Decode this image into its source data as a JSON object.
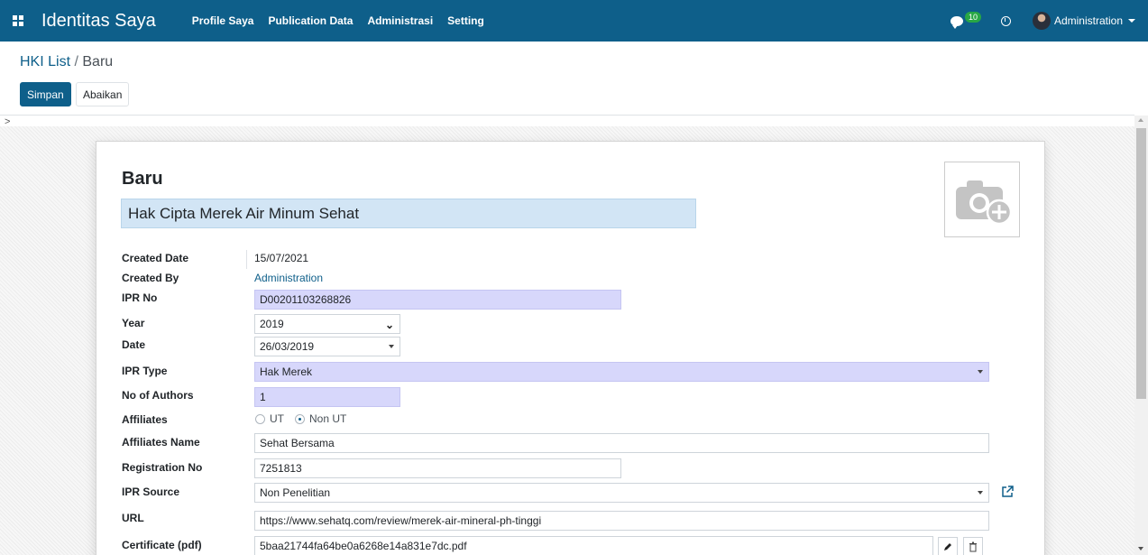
{
  "navbar": {
    "brand": "Identitas Saya",
    "menu": [
      "Profile Saya",
      "Publication Data",
      "Administrasi",
      "Setting"
    ],
    "message_count": "10",
    "user_name": "Administration",
    "color": "#0e5f8a"
  },
  "breadcrumb": {
    "parent": "HKI List",
    "separator": "/",
    "current": "Baru"
  },
  "actions": {
    "save_label": "Simpan",
    "discard_label": "Abaikan"
  },
  "form": {
    "title_label": "Baru",
    "name": "Hak Cipta Merek Air Minum Sehat",
    "fields": {
      "created_date": {
        "label": "Created Date",
        "value": "15/07/2021"
      },
      "created_by": {
        "label": "Created By",
        "value": "Administration"
      },
      "ipr_no": {
        "label": "IPR No",
        "value": "D00201103268826"
      },
      "year": {
        "label": "Year",
        "value": "2019"
      },
      "date": {
        "label": "Date",
        "value": "26/03/2019"
      },
      "ipr_type": {
        "label": "IPR Type",
        "value": "Hak Merek"
      },
      "no_of_authors": {
        "label": "No of Authors",
        "value": "1"
      },
      "affiliates": {
        "label": "Affiliates",
        "options": [
          "UT",
          "Non UT"
        ],
        "selected": "Non UT"
      },
      "affiliates_name": {
        "label": "Affiliates Name",
        "value": "Sehat Bersama"
      },
      "registration_no": {
        "label": "Registration No",
        "value": "7251813"
      },
      "ipr_source": {
        "label": "IPR Source",
        "value": "Non Penelitian"
      },
      "url": {
        "label": "URL",
        "value": "https://www.sehatq.com/review/merek-air-mineral-ph-tinggi"
      },
      "certificate": {
        "label": "Certificate (pdf)",
        "value": "5baa21744fa64be0a6268e14a831e7dc.pdf"
      }
    }
  },
  "icons": [
    "apps-icon",
    "chat-icon",
    "clock-icon",
    "camera-plus-icon",
    "external-link-icon",
    "pencil-icon",
    "trash-icon"
  ]
}
